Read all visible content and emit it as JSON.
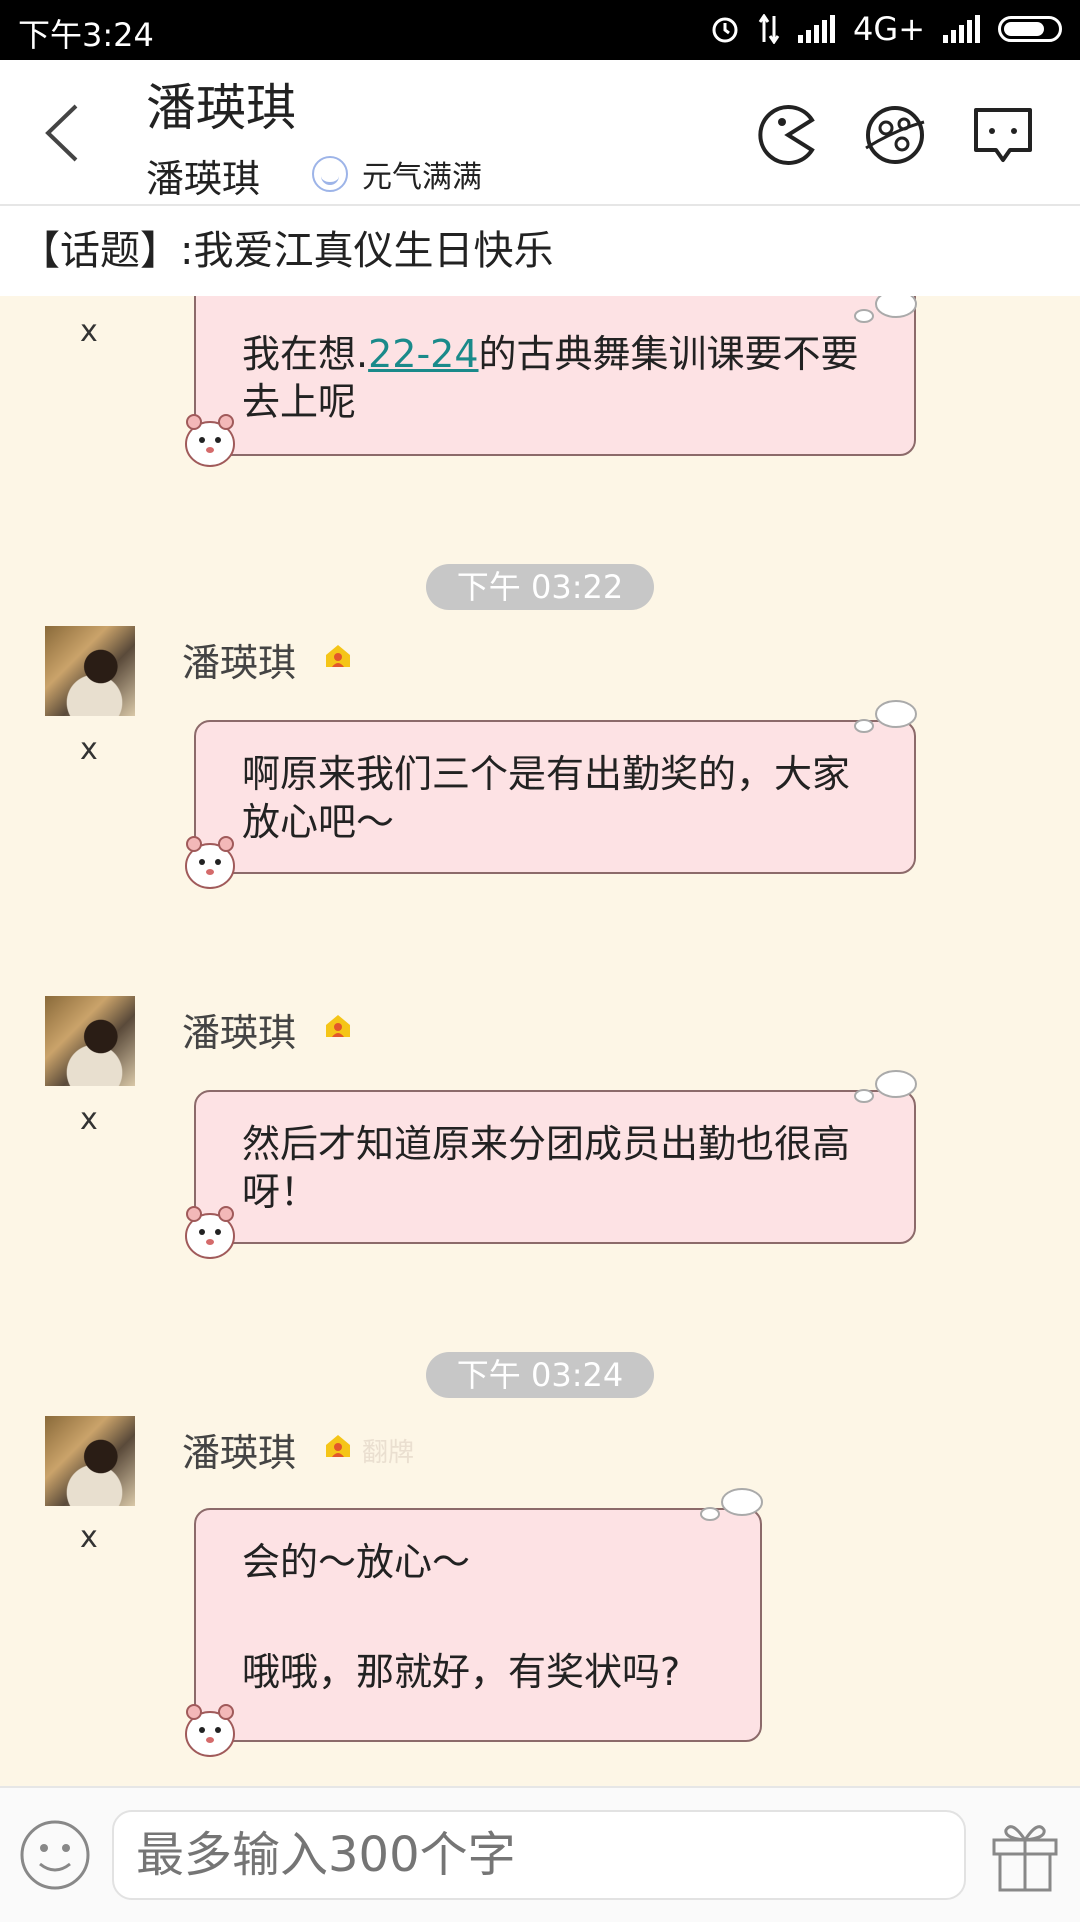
{
  "status_bar": {
    "time": "下午3:24",
    "network": "4G+"
  },
  "header": {
    "title": "潘瑛琪",
    "subtitle": "潘瑛琪",
    "mood": "元气满满"
  },
  "topic": "【话题】:我爱江真仪生日快乐",
  "messages": [
    {
      "x_label": "x",
      "text_before": "我在想.",
      "link": "22-24",
      "text_after": "的古典舞集训课要不要去上呢"
    },
    {
      "timestamp": "下午 03:22"
    },
    {
      "sender": "潘瑛琪",
      "x_label": "x",
      "text": "啊原来我们三个是有出勤奖的，大家放心吧～"
    },
    {
      "sender": "潘瑛琪",
      "x_label": "x",
      "text": "然后才知道原来分团成员出勤也很高呀！"
    },
    {
      "timestamp": "下午 03:24"
    },
    {
      "sender": "潘瑛琪",
      "x_label": "x",
      "flip_label": "翻牌",
      "line1": "会的～放心～",
      "line2": "哦哦，那就好，有奖状吗?"
    }
  ],
  "input": {
    "placeholder": "最多输入300个字"
  }
}
